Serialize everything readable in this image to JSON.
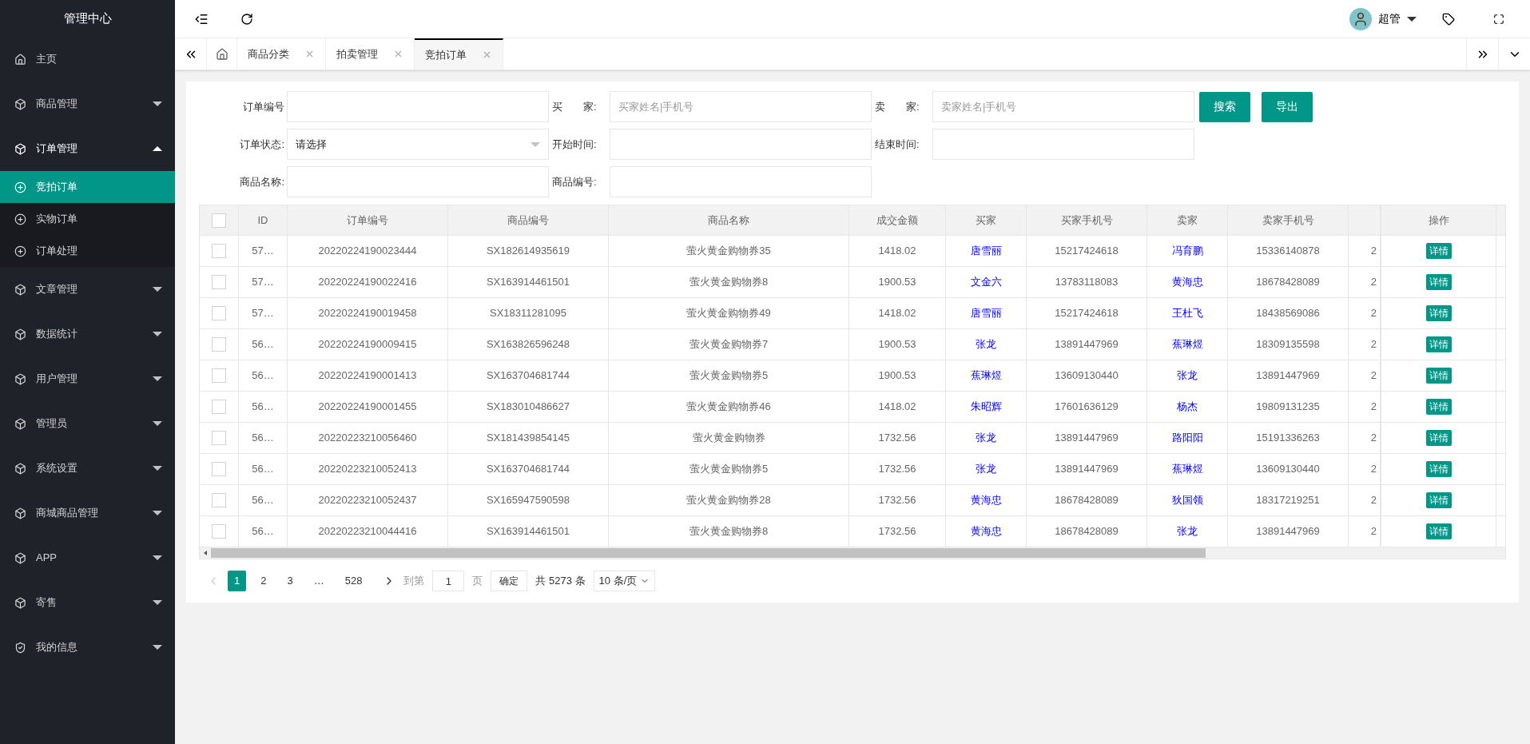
{
  "sidebar": {
    "title": "管理中心",
    "items": [
      {
        "label": "主页",
        "expanded": false
      },
      {
        "label": "商品管理",
        "expanded": false
      },
      {
        "label": "订单管理",
        "expanded": true,
        "children": [
          {
            "label": "竞拍订单",
            "selected": true
          },
          {
            "label": "实物订单",
            "selected": false
          },
          {
            "label": "订单处理",
            "selected": false
          }
        ]
      },
      {
        "label": "文章管理",
        "expanded": false
      },
      {
        "label": "数据统计",
        "expanded": false
      },
      {
        "label": "用户管理",
        "expanded": false
      },
      {
        "label": "管理员",
        "expanded": false
      },
      {
        "label": "系统设置",
        "expanded": false
      },
      {
        "label": "商城商品管理",
        "expanded": false
      },
      {
        "label": "APP",
        "expanded": false
      },
      {
        "label": "寄售",
        "expanded": false
      },
      {
        "label": "我的信息",
        "expanded": false
      }
    ]
  },
  "header": {
    "user": "超管"
  },
  "tabs": [
    {
      "label": "商品分类",
      "selected": false
    },
    {
      "label": "拍卖管理",
      "selected": false
    },
    {
      "label": "竞拍订单",
      "selected": true
    }
  ],
  "filters": [
    [
      {
        "label": "订单编号",
        "kind": "input"
      },
      {
        "label": "买　　家:",
        "kind": "input",
        "placeholder": "买家姓名|手机号"
      },
      {
        "label": "卖　　家:",
        "kind": "input",
        "placeholder": "卖家姓名|手机号"
      }
    ],
    [
      {
        "label": "订单状态:",
        "kind": "select",
        "value": "请选择"
      },
      {
        "label": "开始时间:",
        "kind": "input"
      },
      {
        "label": "结束时间:",
        "kind": "input"
      }
    ],
    [
      {
        "label": "商品名称:",
        "kind": "input"
      },
      {
        "label": "商品编号:",
        "kind": "input"
      }
    ]
  ],
  "buttons": [
    "搜索",
    "导出"
  ],
  "table": {
    "all_checked": false,
    "columns": [
      "ID",
      "订单编号",
      "商品编号",
      "商品名称",
      "成交金额",
      "买家",
      "买家手机号",
      "卖家",
      "卖家手机号",
      "",
      "操作"
    ],
    "rows": [
      {
        "checked": false,
        "cells": [
          "57…",
          "20220224190023444",
          "SX182614935619",
          "萤火黄金购物券35",
          "1418.02",
          "唐雪丽",
          "15217424618",
          "冯育鹏",
          "15336140878",
          "2",
          "详情"
        ]
      },
      {
        "checked": false,
        "cells": [
          "57…",
          "20220224190022416",
          "SX163914461501",
          "萤火黄金购物券8",
          "1900.53",
          "文金六",
          "13783118083",
          "黄海忠",
          "18678428089",
          "2",
          "详情"
        ]
      },
      {
        "checked": false,
        "cells": [
          "57…",
          "20220224190019458",
          "SX18311281095",
          "萤火黄金购物券49",
          "1418.02",
          "唐雪丽",
          "15217424618",
          "王杜飞",
          "18438569086",
          "2",
          "详情"
        ]
      },
      {
        "checked": false,
        "cells": [
          "56…",
          "20220224190009415",
          "SX163826596248",
          "萤火黄金购物券7",
          "1900.53",
          "张龙",
          "13891447969",
          "蕉琳煜",
          "18309135598",
          "2",
          "详情"
        ]
      },
      {
        "checked": false,
        "cells": [
          "56…",
          "20220224190001413",
          "SX163704681744",
          "萤火黄金购物券5",
          "1900.53",
          "蕉琳煜",
          "13609130440",
          "张龙",
          "13891447969",
          "2",
          "详情"
        ]
      },
      {
        "checked": false,
        "cells": [
          "56…",
          "20220224190001455",
          "SX183010486627",
          "萤火黄金购物券46",
          "1418.02",
          "朱昭辉",
          "17601636129",
          "杨杰",
          "19809131235",
          "2",
          "详情"
        ]
      },
      {
        "checked": false,
        "cells": [
          "56…",
          "20220223210056460",
          "SX181439854145",
          "萤火黄金购物券",
          "1732.56",
          "张龙",
          "13891447969",
          "路阳阳",
          "15191336263",
          "2",
          "详情"
        ]
      },
      {
        "checked": false,
        "cells": [
          "56…",
          "20220223210052413",
          "SX163704681744",
          "萤火黄金购物券5",
          "1732.56",
          "张龙",
          "13891447969",
          "蕉琳煜",
          "13609130440",
          "2",
          "详情"
        ]
      },
      {
        "checked": false,
        "cells": [
          "56…",
          "20220223210052437",
          "SX165947590598",
          "萤火黄金购物券28",
          "1732.56",
          "黄海忠",
          "18678428089",
          "狄国领",
          "18317219251",
          "2",
          "详情"
        ]
      },
      {
        "checked": false,
        "cells": [
          "56…",
          "20220223210044416",
          "SX163914461501",
          "萤火黄金购物券8",
          "1732.56",
          "黄海忠",
          "18678428089",
          "张龙",
          "13891447969",
          "2",
          "详情"
        ]
      }
    ]
  },
  "pagination": {
    "pages": [
      {
        "label": "1",
        "selected": true
      },
      {
        "label": "2",
        "selected": false
      },
      {
        "label": "3",
        "selected": false
      },
      {
        "label": "…",
        "selected": false
      },
      {
        "label": "528",
        "selected": false
      }
    ],
    "goto_label": "到第",
    "goto_value": "1",
    "page_unit": "页",
    "confirm": "确定",
    "total": "共 5273 条",
    "page_size": "10 条/页"
  }
}
